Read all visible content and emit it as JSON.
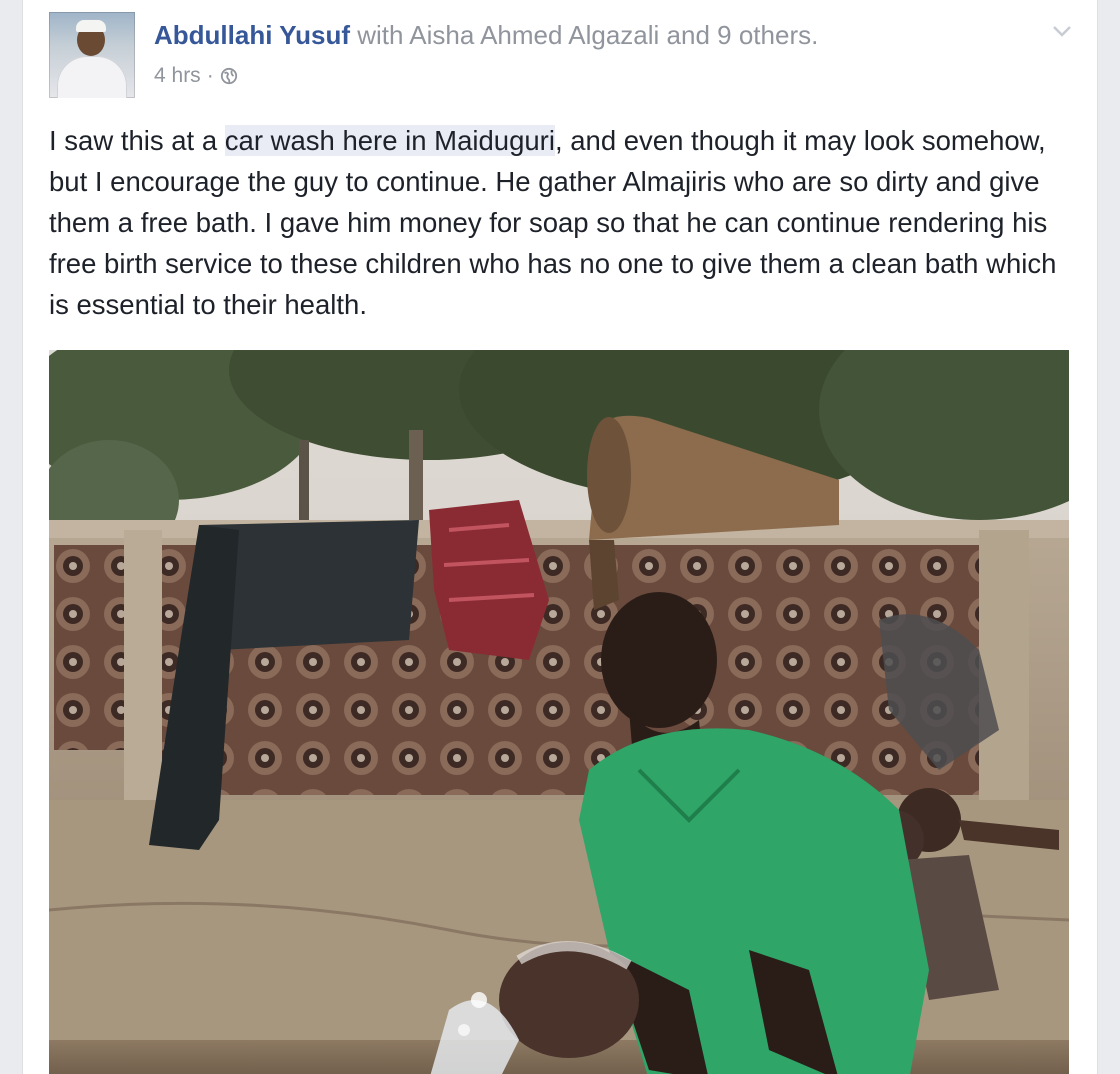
{
  "post": {
    "author": "Abdullahi Yusuf",
    "with_word": "with",
    "tagged": "Aisha Ahmed Algazali",
    "and_others": "and 9 others.",
    "timestamp": "4 hrs",
    "separator": "·",
    "privacy_icon": "globe-icon",
    "options_icon": "chevron-down-icon",
    "text_before_link": "I saw this at a ",
    "link_text": "car wash here in Maiduguri",
    "text_after_link": ", and even though it may look somehow, but I encourage the guy to continue. He gather Almajiris who are so dirty and give them a free bath. I gave him money for soap so that he can continue rendering his free birth service to these children who has no one to give them a clean bath which is essential to their health."
  },
  "colors": {
    "author_link": "#365899",
    "meta_gray": "#90949c",
    "body_text": "#1d2129",
    "shirt_green": "#2fa567",
    "page_bg": "#e9ebee"
  }
}
